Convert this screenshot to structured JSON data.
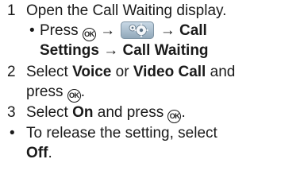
{
  "steps": [
    {
      "num": "1",
      "text": "Open the Call Waiting display."
    },
    {
      "num": "2",
      "text_a": "Select ",
      "bold_a": "Voice",
      "text_b": " or ",
      "bold_b": "Video Call",
      "text_c": " and",
      "text_line2": "press ",
      "text_line2_end": "."
    },
    {
      "num": "3",
      "text_a": "Select ",
      "bold_a": "On",
      "text_b": " and press ",
      "text_c": "."
    }
  ],
  "substep": {
    "bullet": "•",
    "press": "Press ",
    "arrow": "→",
    "call_settings_a": "Call",
    "call_settings_b": "Settings",
    "call_waiting": "Call Waiting"
  },
  "note": {
    "bullet": "•",
    "text": "To release the setting, select",
    "bold": "Off",
    "end": "."
  },
  "icons": {
    "ok_key": "OK",
    "settings": "settings-icon"
  }
}
